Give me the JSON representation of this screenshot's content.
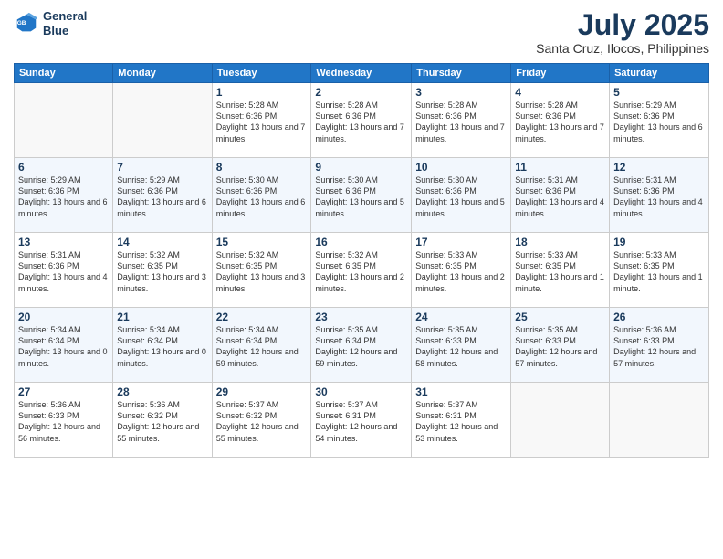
{
  "logo": {
    "line1": "General",
    "line2": "Blue"
  },
  "title": "July 2025",
  "subtitle": "Santa Cruz, Ilocos, Philippines",
  "header_row": [
    "Sunday",
    "Monday",
    "Tuesday",
    "Wednesday",
    "Thursday",
    "Friday",
    "Saturday"
  ],
  "weeks": [
    [
      {
        "day": "",
        "info": ""
      },
      {
        "day": "",
        "info": ""
      },
      {
        "day": "1",
        "info": "Sunrise: 5:28 AM\nSunset: 6:36 PM\nDaylight: 13 hours and 7 minutes."
      },
      {
        "day": "2",
        "info": "Sunrise: 5:28 AM\nSunset: 6:36 PM\nDaylight: 13 hours and 7 minutes."
      },
      {
        "day": "3",
        "info": "Sunrise: 5:28 AM\nSunset: 6:36 PM\nDaylight: 13 hours and 7 minutes."
      },
      {
        "day": "4",
        "info": "Sunrise: 5:28 AM\nSunset: 6:36 PM\nDaylight: 13 hours and 7 minutes."
      },
      {
        "day": "5",
        "info": "Sunrise: 5:29 AM\nSunset: 6:36 PM\nDaylight: 13 hours and 6 minutes."
      }
    ],
    [
      {
        "day": "6",
        "info": "Sunrise: 5:29 AM\nSunset: 6:36 PM\nDaylight: 13 hours and 6 minutes."
      },
      {
        "day": "7",
        "info": "Sunrise: 5:29 AM\nSunset: 6:36 PM\nDaylight: 13 hours and 6 minutes."
      },
      {
        "day": "8",
        "info": "Sunrise: 5:30 AM\nSunset: 6:36 PM\nDaylight: 13 hours and 6 minutes."
      },
      {
        "day": "9",
        "info": "Sunrise: 5:30 AM\nSunset: 6:36 PM\nDaylight: 13 hours and 5 minutes."
      },
      {
        "day": "10",
        "info": "Sunrise: 5:30 AM\nSunset: 6:36 PM\nDaylight: 13 hours and 5 minutes."
      },
      {
        "day": "11",
        "info": "Sunrise: 5:31 AM\nSunset: 6:36 PM\nDaylight: 13 hours and 4 minutes."
      },
      {
        "day": "12",
        "info": "Sunrise: 5:31 AM\nSunset: 6:36 PM\nDaylight: 13 hours and 4 minutes."
      }
    ],
    [
      {
        "day": "13",
        "info": "Sunrise: 5:31 AM\nSunset: 6:36 PM\nDaylight: 13 hours and 4 minutes."
      },
      {
        "day": "14",
        "info": "Sunrise: 5:32 AM\nSunset: 6:35 PM\nDaylight: 13 hours and 3 minutes."
      },
      {
        "day": "15",
        "info": "Sunrise: 5:32 AM\nSunset: 6:35 PM\nDaylight: 13 hours and 3 minutes."
      },
      {
        "day": "16",
        "info": "Sunrise: 5:32 AM\nSunset: 6:35 PM\nDaylight: 13 hours and 2 minutes."
      },
      {
        "day": "17",
        "info": "Sunrise: 5:33 AM\nSunset: 6:35 PM\nDaylight: 13 hours and 2 minutes."
      },
      {
        "day": "18",
        "info": "Sunrise: 5:33 AM\nSunset: 6:35 PM\nDaylight: 13 hours and 1 minute."
      },
      {
        "day": "19",
        "info": "Sunrise: 5:33 AM\nSunset: 6:35 PM\nDaylight: 13 hours and 1 minute."
      }
    ],
    [
      {
        "day": "20",
        "info": "Sunrise: 5:34 AM\nSunset: 6:34 PM\nDaylight: 13 hours and 0 minutes."
      },
      {
        "day": "21",
        "info": "Sunrise: 5:34 AM\nSunset: 6:34 PM\nDaylight: 13 hours and 0 minutes."
      },
      {
        "day": "22",
        "info": "Sunrise: 5:34 AM\nSunset: 6:34 PM\nDaylight: 12 hours and 59 minutes."
      },
      {
        "day": "23",
        "info": "Sunrise: 5:35 AM\nSunset: 6:34 PM\nDaylight: 12 hours and 59 minutes."
      },
      {
        "day": "24",
        "info": "Sunrise: 5:35 AM\nSunset: 6:33 PM\nDaylight: 12 hours and 58 minutes."
      },
      {
        "day": "25",
        "info": "Sunrise: 5:35 AM\nSunset: 6:33 PM\nDaylight: 12 hours and 57 minutes."
      },
      {
        "day": "26",
        "info": "Sunrise: 5:36 AM\nSunset: 6:33 PM\nDaylight: 12 hours and 57 minutes."
      }
    ],
    [
      {
        "day": "27",
        "info": "Sunrise: 5:36 AM\nSunset: 6:33 PM\nDaylight: 12 hours and 56 minutes."
      },
      {
        "day": "28",
        "info": "Sunrise: 5:36 AM\nSunset: 6:32 PM\nDaylight: 12 hours and 55 minutes."
      },
      {
        "day": "29",
        "info": "Sunrise: 5:37 AM\nSunset: 6:32 PM\nDaylight: 12 hours and 55 minutes."
      },
      {
        "day": "30",
        "info": "Sunrise: 5:37 AM\nSunset: 6:31 PM\nDaylight: 12 hours and 54 minutes."
      },
      {
        "day": "31",
        "info": "Sunrise: 5:37 AM\nSunset: 6:31 PM\nDaylight: 12 hours and 53 minutes."
      },
      {
        "day": "",
        "info": ""
      },
      {
        "day": "",
        "info": ""
      }
    ]
  ]
}
